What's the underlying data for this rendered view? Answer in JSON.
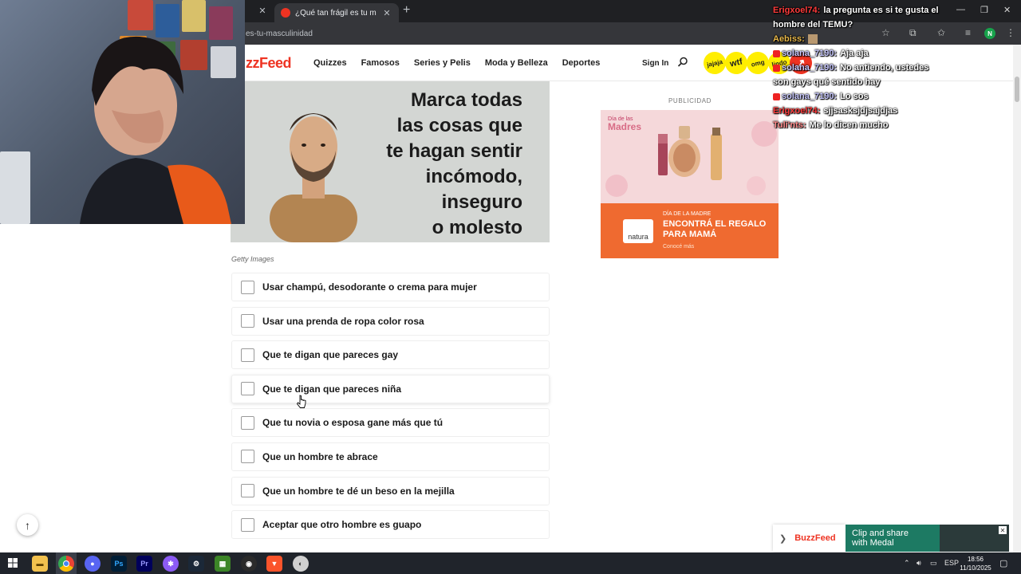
{
  "browser": {
    "tab_title": "¿Qué tan frágil es tu masculinidad?",
    "url": "es-tu-masculinidad",
    "profile_initial": "N"
  },
  "site": {
    "logo": "zzFeed",
    "nav": [
      "Quizzes",
      "Famosos",
      "Series y Pelis",
      "Moda y Belleza",
      "Deportes"
    ],
    "sign_in": "Sign In",
    "badges": [
      "jajaja",
      "wtf",
      "omg",
      "lindo"
    ]
  },
  "article": {
    "hero_lines": [
      "Marca todas",
      "las cosas que",
      "te hagan sentir",
      "incómodo,",
      "inseguro",
      "o molesto"
    ],
    "credit": "Getty Images",
    "items": [
      "Usar champú, desodorante o crema para mujer",
      "Usar una prenda de ropa color rosa",
      "Que te digan que pareces gay",
      "Que te digan que pareces niña",
      "Que tu novia o esposa gane más que tú",
      "Que un hombre te abrace",
      "Que un hombre te dé un beso en la mejilla",
      "Aceptar que otro hombre es guapo"
    ]
  },
  "ad": {
    "label": "PUBLICIDAD",
    "title_small": "Día de las",
    "title": "Madres",
    "logo": "natura",
    "kicker": "DÍA DE LA MADRE",
    "headline": "ENCONTRÁ EL REGALO PARA MAMÁ",
    "cta": "Conocé más"
  },
  "chat": [
    {
      "user": "Erigxoel74:",
      "msg": "la pregunta es si te gusta el hombre del TEMU?",
      "color": "#ff3b3b",
      "mod": false
    },
    {
      "user": "Aebiss:",
      "msg": "",
      "color": "#e8b84a",
      "mod": false
    },
    {
      "user": "solana_7190:",
      "msg": "Aja aja",
      "color": "#c9c9ff",
      "mod": true
    },
    {
      "user": "solana_7190:",
      "msg": "No antiendo, ustedes son gays qué sentido hay",
      "color": "#c9c9ff",
      "mod": true
    },
    {
      "user": "solana_7190:",
      "msg": "Lo sos",
      "color": "#c9c9ff",
      "mod": true
    },
    {
      "user": "Erigxoel74:",
      "msg": "sjjsasksjdjsajdjas",
      "color": "#ff3b3b",
      "mod": false
    },
    {
      "user": "Tuli'nts:",
      "msg": "Me lo dicen mucho",
      "color": "#ff8a8a",
      "mod": false
    }
  ],
  "sticky": {
    "brand": "BuzzFeed",
    "medal_text_1": "Clip and share",
    "medal_text_2": "with Medal"
  },
  "taskbar": {
    "lang": "ESP",
    "time": "18:56",
    "date": "11/10/2025"
  },
  "colors": {
    "brand_red": "#ee3322",
    "ad_orange": "#ef6a30",
    "badge_yellow": "#ffee00"
  }
}
